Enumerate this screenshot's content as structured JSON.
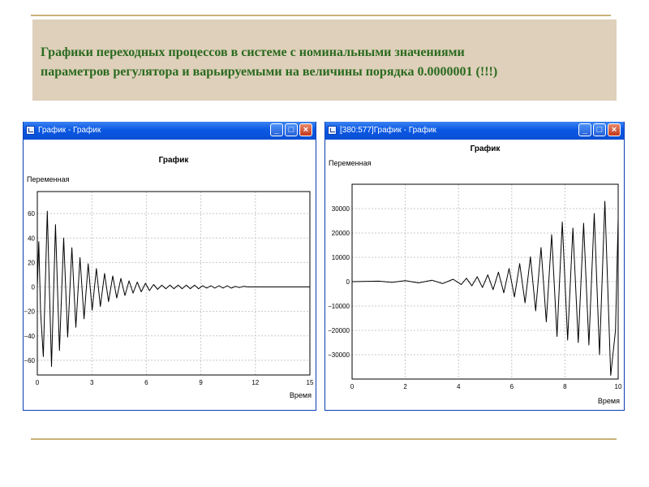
{
  "slide": {
    "title_line1": "Графики переходных процессов в системе с номинальными значениями",
    "title_line2": "параметров регулятора и варьируемыми на величины порядка 0.0000001 (!!!)"
  },
  "windows": [
    {
      "title": "График - График",
      "colors": {
        "titlebar": "#0b58e4",
        "close": "#c2391b"
      }
    },
    {
      "title": "[380:577]График - График",
      "colors": {
        "titlebar": "#0b58e4",
        "close": "#c2391b"
      }
    }
  ],
  "chart_data": [
    {
      "type": "line",
      "title": "График",
      "xlabel": "Время",
      "ylabel": "Переменная",
      "xlim": [
        0,
        15
      ],
      "ylim": [
        -72,
        78
      ],
      "xticks": [
        0,
        3,
        6,
        9,
        12,
        15
      ],
      "yticks": [
        60,
        40,
        20,
        0,
        -20,
        -40,
        -60
      ],
      "grid": true,
      "series": [
        {
          "x": [
            0,
            0.08,
            0.18,
            0.33,
            0.55,
            0.78,
            1.0,
            1.22,
            1.45,
            1.67,
            1.9,
            2.12,
            2.35,
            2.57,
            2.8,
            3.02,
            3.25,
            3.47,
            3.7,
            3.92,
            4.15,
            4.37,
            4.6,
            4.82,
            5.05,
            5.27,
            5.5,
            5.72,
            5.95,
            6.17,
            6.4,
            6.62,
            6.85,
            7.07,
            7.3,
            7.52,
            7.75,
            7.97,
            8.2,
            8.42,
            8.65,
            8.87,
            9.1,
            9.32,
            9.55,
            9.77,
            10.0,
            10.22,
            10.45,
            10.67,
            10.9,
            11.12,
            11.35,
            11.6,
            15
          ],
          "y": [
            0,
            37,
            -20,
            -57,
            62,
            -65,
            51,
            -52,
            40,
            -41,
            32,
            -33,
            24,
            -26,
            19,
            -19,
            15,
            -16,
            11,
            -12,
            9,
            -9,
            7,
            -7,
            5,
            -5,
            4,
            -4,
            3,
            -3,
            2,
            -2,
            1.5,
            -1.5,
            1.5,
            -1.5,
            1.5,
            -1.5,
            1.5,
            -1.5,
            1.5,
            -1.5,
            1,
            -1,
            1,
            -1,
            1,
            -1,
            1,
            -1,
            0.5,
            -0.5,
            0.5,
            0,
            0
          ],
          "color": "#000000"
        }
      ]
    },
    {
      "type": "line",
      "title": "График",
      "xlabel": "Время",
      "ylabel": "Переменная",
      "xlim": [
        0,
        10
      ],
      "ylim": [
        -40000,
        40000
      ],
      "xticks": [
        0,
        2,
        4,
        6,
        8,
        10
      ],
      "yticks": [
        30000,
        20000,
        10000,
        0,
        -10000,
        -20000,
        -30000
      ],
      "grid": true,
      "series": [
        {
          "x": [
            0,
            1.0,
            1.5,
            2.0,
            2.5,
            3.0,
            3.4,
            3.8,
            4.1,
            4.3,
            4.5,
            4.7,
            4.9,
            5.1,
            5.3,
            5.5,
            5.7,
            5.9,
            6.1,
            6.3,
            6.5,
            6.7,
            6.9,
            7.1,
            7.3,
            7.5,
            7.7,
            7.9,
            8.1,
            8.3,
            8.5,
            8.7,
            8.9,
            9.1,
            9.3,
            9.5,
            9.72,
            9.9,
            10.0
          ],
          "y": [
            0,
            200,
            -300,
            400,
            -500,
            600,
            -800,
            1000,
            -1200,
            1400,
            -1700,
            2000,
            -2400,
            2800,
            -3300,
            3900,
            -4600,
            5400,
            -6300,
            7400,
            -8700,
            10200,
            -12000,
            14000,
            -16500,
            19300,
            -22500,
            24500,
            -24000,
            22000,
            -25000,
            24000,
            -26000,
            28000,
            -30000,
            33000,
            -38500,
            -20000,
            26000
          ],
          "color": "#000000"
        }
      ]
    }
  ]
}
